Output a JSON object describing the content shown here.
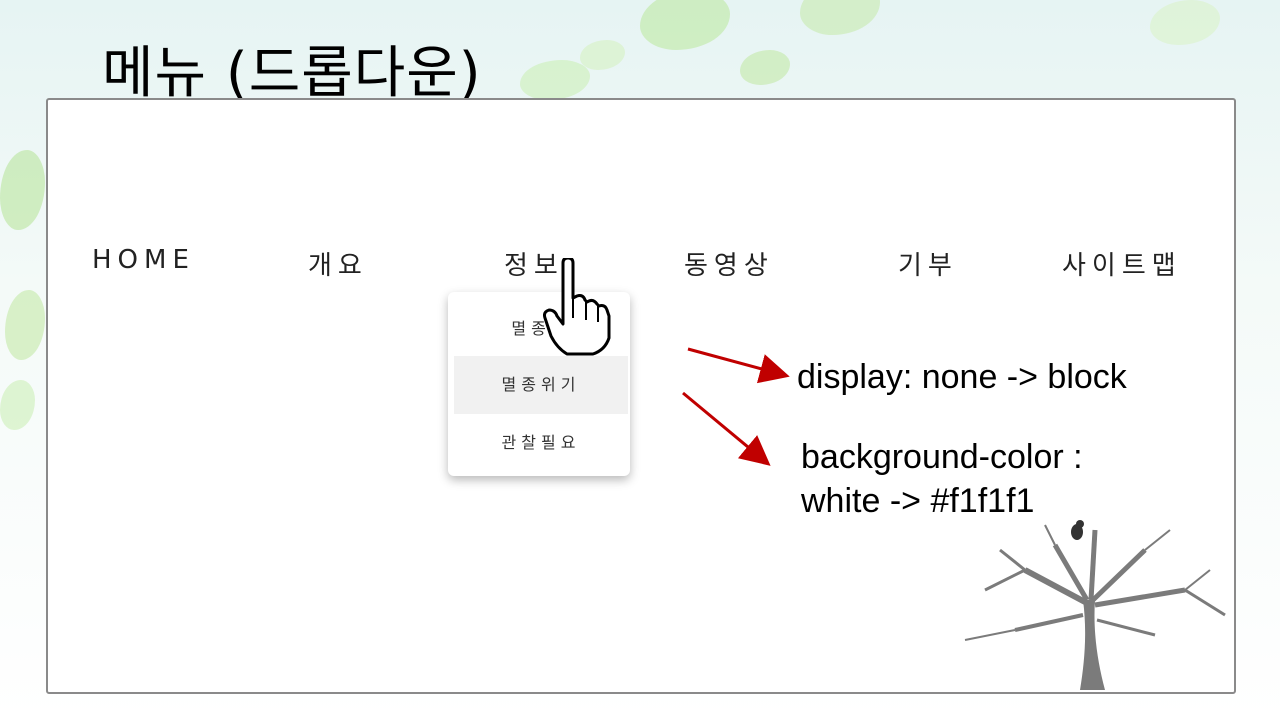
{
  "slide": {
    "title": "메뉴 (드롭다운)"
  },
  "nav": {
    "items": [
      {
        "label": "HOME"
      },
      {
        "label": "개요"
      },
      {
        "label": "정보"
      },
      {
        "label": "동영상"
      },
      {
        "label": "기부"
      },
      {
        "label": "사이트맵"
      }
    ]
  },
  "dropdown": {
    "items": [
      {
        "label": "멸종된"
      },
      {
        "label": "멸종위기",
        "active_bg": "#f1f1f1"
      },
      {
        "label": "관찰필요"
      }
    ]
  },
  "notes": {
    "display_note": "display: none -> block",
    "bg_note_line1": "background-color :",
    "bg_note_line2": "white -> #f1f1f1"
  },
  "colors": {
    "arrow": "#c00000",
    "hover_bg": "#f1f1f1",
    "frame_border": "#8a8a8a"
  },
  "icons": {
    "cursor": "hand-pointer-icon",
    "decoration": "tree-with-bird-illustration"
  }
}
